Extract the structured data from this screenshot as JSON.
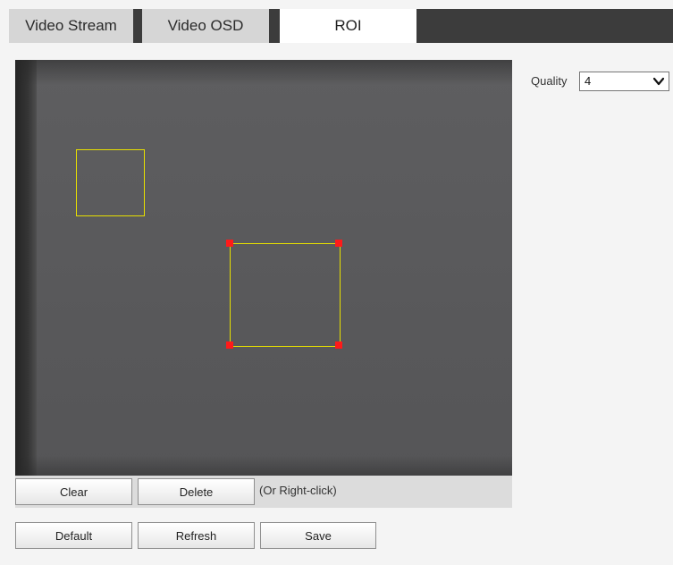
{
  "tabs": [
    {
      "label": "Video Stream",
      "active": false
    },
    {
      "label": "Video OSD",
      "active": false
    },
    {
      "label": "ROI",
      "active": true
    }
  ],
  "quality": {
    "label": "Quality",
    "value": "4",
    "icon": "chevron-down-icon"
  },
  "editor": {
    "buttons": {
      "clear": "Clear",
      "delete": "Delete"
    },
    "hint": "(Or Right-click)"
  },
  "footer": {
    "default": "Default",
    "refresh": "Refresh",
    "save": "Save"
  },
  "colors": {
    "roi_border": "#e8e000",
    "roi_handle": "#ff1a1a",
    "tab_bar_dark": "#3c3c3c"
  }
}
